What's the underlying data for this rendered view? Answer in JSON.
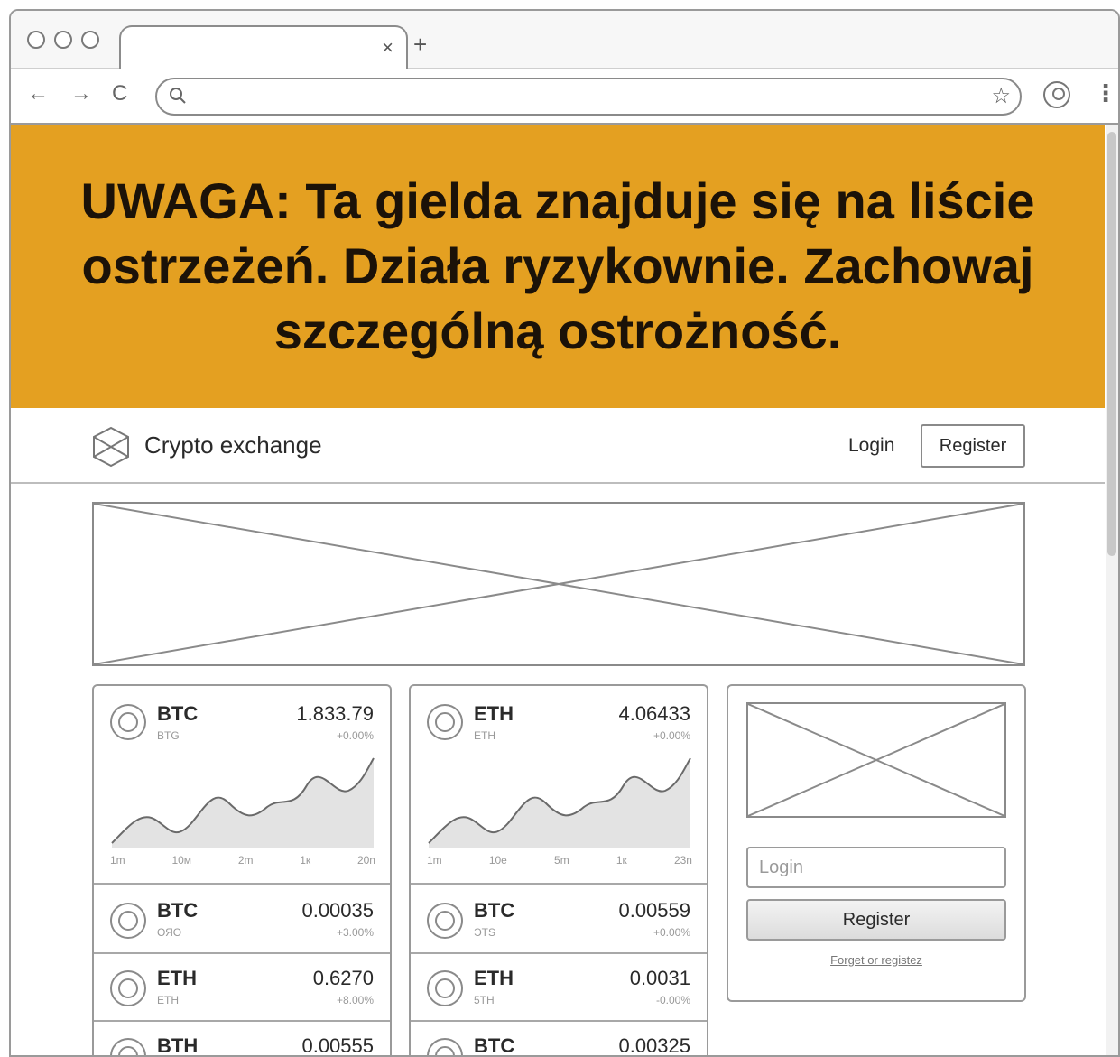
{
  "browser": {
    "tab_close": "×",
    "new_tab": "+",
    "nav_back": "←",
    "nav_forward": "→",
    "nav_reload": "C",
    "address": "",
    "bookmark_icon": "star-icon",
    "menu": "⋮"
  },
  "warning": {
    "text": "UWAGA: Ta gielda znajduje się na liście ostrzeżeń. Działa ryzykownie. Zachowaj szczególną ostrożność.",
    "background": "#e4a021"
  },
  "site": {
    "brand": "Crypto exchange",
    "login_link": "Login",
    "register_button": "Register"
  },
  "ticker_columns": [
    {
      "feature": {
        "symbol": "BTC",
        "sub": "BTG",
        "price": "1.833.79",
        "change": "+0.00%",
        "ticks": [
          "1m",
          "10м",
          "2m",
          "1к",
          "20n"
        ]
      },
      "rows": [
        {
          "symbol": "BTC",
          "sub": "ОЯО",
          "price": "0.00035",
          "change": "+3.00%"
        },
        {
          "symbol": "ETH",
          "sub": "ETH",
          "price": "0.6270",
          "change": "+8.00%"
        },
        {
          "symbol": "BTH",
          "sub": "",
          "price": "0.00555",
          "change": ""
        }
      ]
    },
    {
      "feature": {
        "symbol": "ETH",
        "sub": "ETH",
        "price": "4.06433",
        "change": "+0.00%",
        "ticks": [
          "1m",
          "10e",
          "5m",
          "1к",
          "23n"
        ]
      },
      "rows": [
        {
          "symbol": "BTC",
          "sub": "ЭТS",
          "price": "0.00559",
          "change": "+0.00%"
        },
        {
          "symbol": "ETH",
          "sub": "5TH",
          "price": "0.0031",
          "change": "-0.00%"
        },
        {
          "symbol": "BTC",
          "sub": "",
          "price": "0.00325",
          "change": ""
        }
      ]
    }
  ],
  "login_card": {
    "login_placeholder": "Login",
    "register_button": "Register",
    "forgot_link": "Forget or registez"
  }
}
